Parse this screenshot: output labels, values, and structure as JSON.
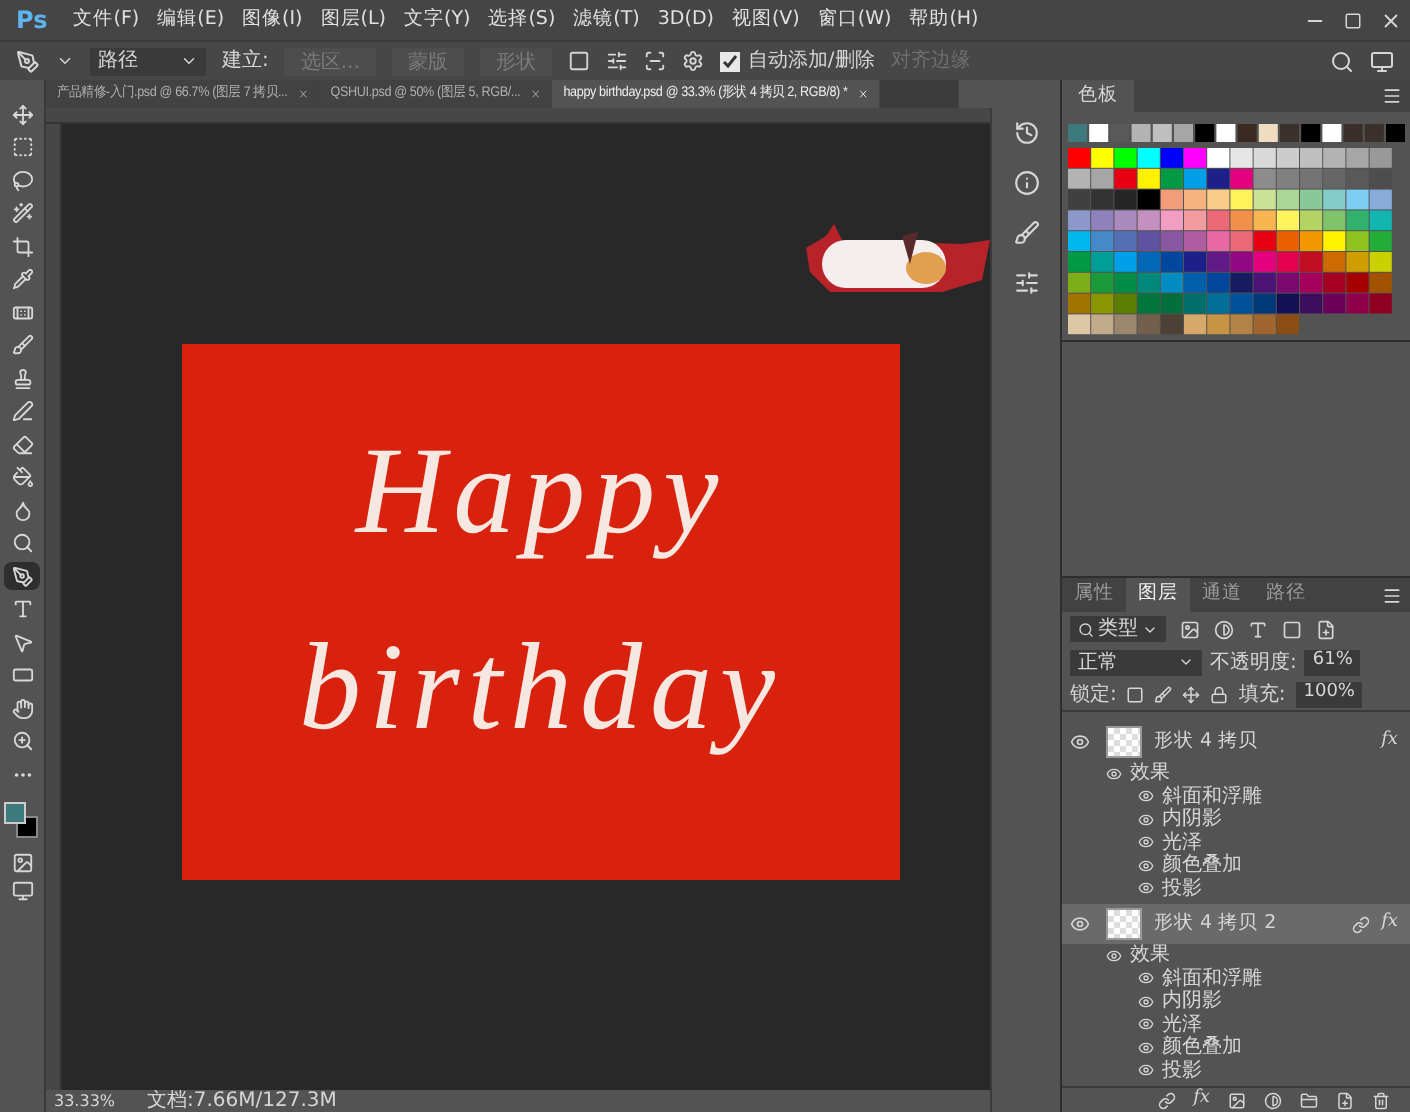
{
  "app": {
    "logo": "Ps"
  },
  "menu": [
    "文件(F)",
    "编辑(E)",
    "图像(I)",
    "图层(L)",
    "文字(Y)",
    "选择(S)",
    "滤镜(T)",
    "3D(D)",
    "视图(V)",
    "窗口(W)",
    "帮助(H)"
  ],
  "options_bar": {
    "mode": "路径",
    "make_label": "建立:",
    "buttons": [
      {
        "label": "选区...",
        "disabled": true
      },
      {
        "label": "蒙版",
        "disabled": true
      },
      {
        "label": "形状",
        "disabled": true
      }
    ],
    "auto_add_delete": {
      "label": "自动添加/删除",
      "checked": true
    },
    "align_edges": {
      "label": "对齐边缘",
      "disabled": true
    }
  },
  "document_tabs": [
    {
      "title": "产品精修-入门.psd @ 66.7% (图层 7 拷贝...",
      "selected": false
    },
    {
      "title": "QSHUI.psd @ 50% (图层 5, RGB/...",
      "selected": false
    },
    {
      "title": "happy birthday.psd @ 33.3% (形状 4 拷贝 2, RGB/8) *",
      "selected": true
    }
  ],
  "tools": [
    {
      "selected": false
    },
    {
      "selected": false
    },
    {
      "selected": false
    },
    {
      "selected": false
    },
    {
      "selected": false
    },
    {
      "selected": false
    },
    {
      "selected": false
    },
    {
      "selected": false
    },
    {
      "selected": false
    },
    {
      "selected": false
    },
    {
      "selected": false
    },
    {
      "selected": false
    },
    {
      "selected": false
    },
    {
      "selected": false
    },
    {
      "selected": true
    },
    {
      "selected": false
    },
    {
      "selected": false
    },
    {
      "selected": false
    },
    {
      "selected": false
    },
    {
      "selected": false
    },
    {
      "selected": false
    }
  ],
  "canvas": {
    "lines": [
      "Happy",
      "birthday"
    ]
  },
  "swatches_panel": {
    "title": "色板"
  },
  "layers_panel": {
    "tabs": [
      {
        "label": "属性",
        "selected": false
      },
      {
        "label": "图层",
        "selected": true
      },
      {
        "label": "通道",
        "selected": false
      },
      {
        "label": "路径",
        "selected": false
      }
    ],
    "filter": "类型",
    "fx_button": "fx",
    "blend_mode": "正常",
    "opacity_label": "不透明度:",
    "opacity": "61%",
    "lock_label": "锁定:",
    "fill_label": "填充:",
    "fill": "100%",
    "layers": [
      {
        "name": "形状 4 拷贝",
        "fx": "fx",
        "selected": false,
        "visible": true,
        "effects_label": "效果",
        "effects": [
          {
            "name": "斜面和浮雕",
            "visible": true
          },
          {
            "name": "内阴影",
            "visible": true
          },
          {
            "name": "光泽",
            "visible": true
          },
          {
            "name": "颜色叠加",
            "visible": true
          },
          {
            "name": "投影",
            "visible": true
          }
        ]
      },
      {
        "name": "形状 4 拷贝 2",
        "fx": "fx",
        "selected": true,
        "visible": true,
        "effects_label": "效果",
        "effects": [
          {
            "name": "斜面和浮雕",
            "visible": true
          },
          {
            "name": "内阴影",
            "visible": true
          },
          {
            "name": "光泽",
            "visible": true
          },
          {
            "name": "颜色叠加",
            "visible": true
          },
          {
            "name": "投影",
            "visible": true
          }
        ]
      }
    ]
  },
  "status_bar": {
    "zoom": "33.33%",
    "doc_size": "文档:7.66M/127.3M"
  }
}
